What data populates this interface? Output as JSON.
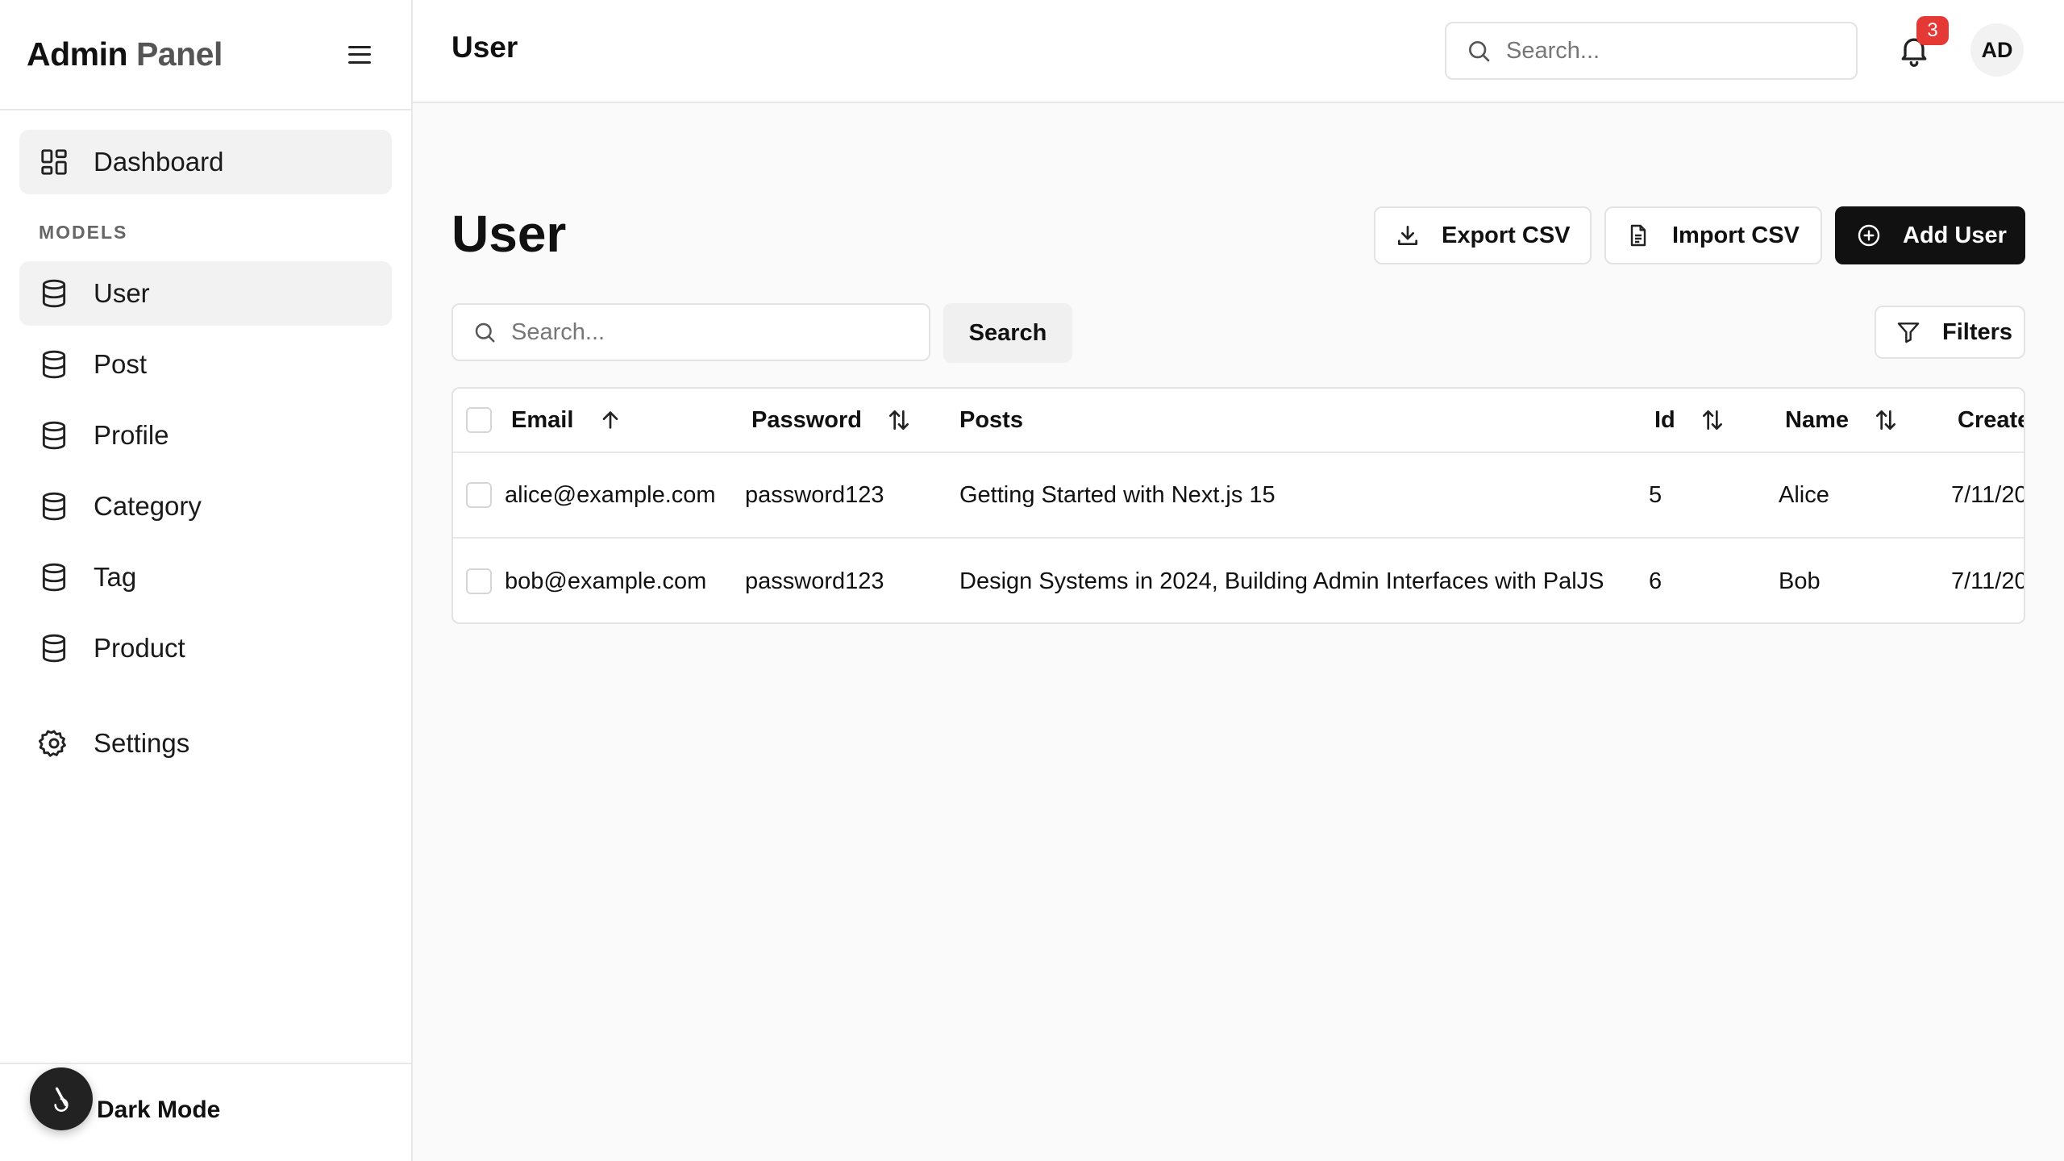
{
  "sidebar": {
    "brand_primary": "Admin",
    "brand_secondary": "Panel",
    "dashboard_label": "Dashboard",
    "section_label": "MODELS",
    "models": [
      "User",
      "Post",
      "Profile",
      "Category",
      "Tag",
      "Product"
    ],
    "settings_label": "Settings",
    "dark_mode_label": "Dark Mode"
  },
  "topbar": {
    "crumb": "User",
    "search_placeholder": "Search...",
    "notification_count": "3",
    "avatar_initials": "AD"
  },
  "page": {
    "title": "User",
    "export_label": "Export CSV",
    "import_label": "Import CSV",
    "add_label": "Add User",
    "search_placeholder": "Search...",
    "search_button": "Search",
    "filters_label": "Filters"
  },
  "table": {
    "columns": [
      "Email",
      "Password",
      "Posts",
      "Id",
      "Name",
      "Create"
    ],
    "rows": [
      {
        "email": "alice@example.com",
        "password": "password123",
        "posts": "Getting Started with Next.js 15",
        "id": "5",
        "name": "Alice",
        "created": "7/11/20"
      },
      {
        "email": "bob@example.com",
        "password": "password123",
        "posts": "Design Systems in 2024, Building Admin Interfaces with PalJS",
        "id": "6",
        "name": "Bob",
        "created": "7/11/20"
      }
    ]
  },
  "colors": {
    "accent": "#111111",
    "badge": "#e53935",
    "border": "#e3e3e3",
    "active_bg": "#f2f2f2"
  }
}
